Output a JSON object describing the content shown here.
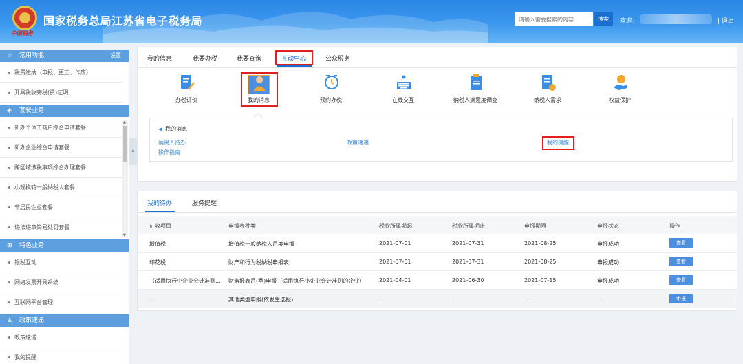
{
  "header": {
    "title": "国家税务总局江苏省电子税务局",
    "emblem_script": "中国税务",
    "search_placeholder": "请输入需要搜索的内容",
    "search_button": "搜索",
    "welcome": "欢迎，",
    "logout": "| 退出"
  },
  "sidebar": {
    "sections": [
      {
        "title": "常用功能",
        "icon": "star-icon",
        "setting": "设置",
        "items": [
          "税费缴纳（申报、更正、作废）",
          "开具税收完税(费)证明"
        ]
      },
      {
        "title": "套餐业务",
        "icon": "layers-icon",
        "items": [
          "新办个体工商户综合申请套餐",
          "新办企业综合申请套餐",
          "跨区域涉税事项综合办理套餐",
          "小规模转一般纳税人套餐",
          "非居民企业套餐",
          "违法违章简易处罚套餐"
        ]
      },
      {
        "title": "特色业务",
        "icon": "grid-icon",
        "items": [
          "银税互动",
          "网络发票开具系统",
          "互联网平台管理"
        ]
      },
      {
        "title": "政策速递",
        "icon": "user-icon",
        "items": [
          "政策速递",
          "我的提醒"
        ]
      }
    ]
  },
  "top_tabs": [
    "我的信息",
    "我要办税",
    "我要查询",
    "互动中心",
    "公众服务"
  ],
  "services": [
    {
      "label": "办税评价",
      "icon": "evaluation-icon"
    },
    {
      "label": "我的消息",
      "icon": "message-icon"
    },
    {
      "label": "预约办税",
      "icon": "alarm-clock-icon"
    },
    {
      "label": "在线交互",
      "icon": "keyboard-icon"
    },
    {
      "label": "纳税人满意度调查",
      "icon": "survey-icon"
    },
    {
      "label": "纳税人需求",
      "icon": "demand-icon"
    },
    {
      "label": "权益保护",
      "icon": "rights-icon"
    }
  ],
  "messages": {
    "title": "我的消息",
    "links": [
      "纳税人待办",
      "政策速递",
      "我的提醒",
      "操作指南"
    ]
  },
  "lower_tabs": [
    "我的待办",
    "服务提醒"
  ],
  "table": {
    "headers": [
      "征收项目",
      "申报表种类",
      "税款所属期起",
      "税款所属期止",
      "申报期限",
      "申报状态",
      "操作"
    ],
    "rows": [
      [
        "增值税",
        "增值税一般纳税人月度申报",
        "2021-07-01",
        "2021-07-31",
        "2021-08-25",
        "申报成功",
        "查看"
      ],
      [
        "印花税",
        "财产和行为税纳税申报表",
        "2021-07-01",
        "2021-07-31",
        "2021-08-25",
        "申报成功",
        "查看"
      ],
      [
        "（适用执行小企业会计准则...",
        "财务报表月(季)申报（适用执行小企业会计准则的企业）",
        "2021-04-01",
        "2021-06-30",
        "2021-07-15",
        "申报成功",
        "查看"
      ],
      [
        "---",
        "其他类型申报(依发生选报)",
        "---",
        "---",
        "---",
        "---",
        "申报"
      ]
    ]
  },
  "colors": {
    "brand": "#2c86e6",
    "accent": "#1a6fd0",
    "highlight": "#e02020",
    "sidebar_head": "#5c9ede"
  }
}
